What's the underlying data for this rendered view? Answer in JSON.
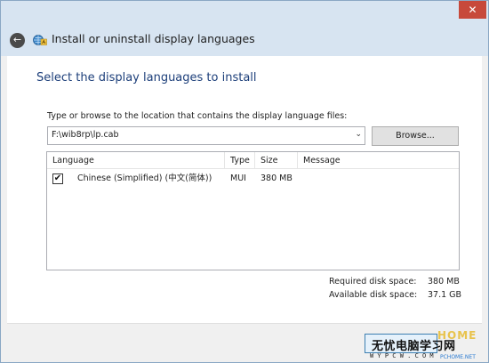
{
  "window": {
    "close_glyph": "✕",
    "back_glyph": "←",
    "title": "Install or uninstall display languages",
    "title_icon": "globe-language-icon"
  },
  "main": {
    "heading": "Select the display languages to install",
    "instruction": "Type or browse to the location that contains the display language files:",
    "path": {
      "value": "F:\\wib8rp\\lp.cab",
      "arrow_glyph": "⌄"
    },
    "browse_label": "Browse..."
  },
  "table": {
    "columns": [
      "Language",
      "Type",
      "Size",
      "Message"
    ],
    "rows": [
      {
        "checked": true,
        "check_glyph": "✔",
        "language": "Chinese (Simplified) (中文(简体))",
        "type": "MUI",
        "size": "380 MB",
        "message": ""
      }
    ]
  },
  "disk": {
    "required_label": "Required disk space:",
    "required_value": "380 MB",
    "available_label": "Available disk space:",
    "available_value": "37.1 GB"
  },
  "watermark": {
    "chinese": "无忧电脑学习网",
    "url": "W Y P C W . C O M",
    "logo": "HOME",
    "url2": "PCHOME.NET"
  },
  "colors": {
    "accent": "#1d3f7a",
    "titlebar": "#d7e4f1",
    "close": "#c7493b"
  }
}
